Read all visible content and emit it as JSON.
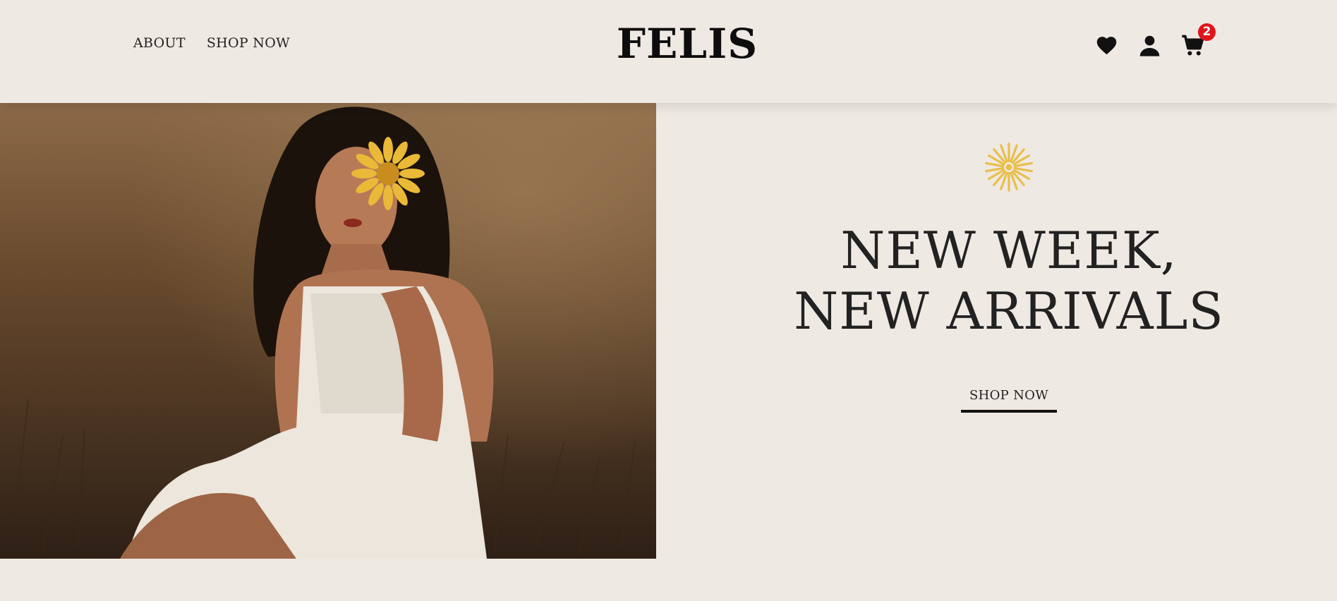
{
  "header": {
    "nav": [
      {
        "label": "ABOUT"
      },
      {
        "label": "SHOP NOW"
      }
    ],
    "logo": "FELIS",
    "icons": {
      "wishlist": "heart-icon",
      "account": "user-icon",
      "cart": "cart-icon",
      "cart_count": "2"
    }
  },
  "hero": {
    "image": "woman-in-white-dress-with-yellow-flower",
    "sun_icon": "sun-burst-icon",
    "headline": "NEW WEEK, NEW ARRIVALS",
    "cta_label": "SHOP NOW"
  },
  "colors": {
    "background": "#efe9e3",
    "text": "#222222",
    "accent_yellow": "#e8bf4a",
    "badge_red": "#e0151b"
  }
}
